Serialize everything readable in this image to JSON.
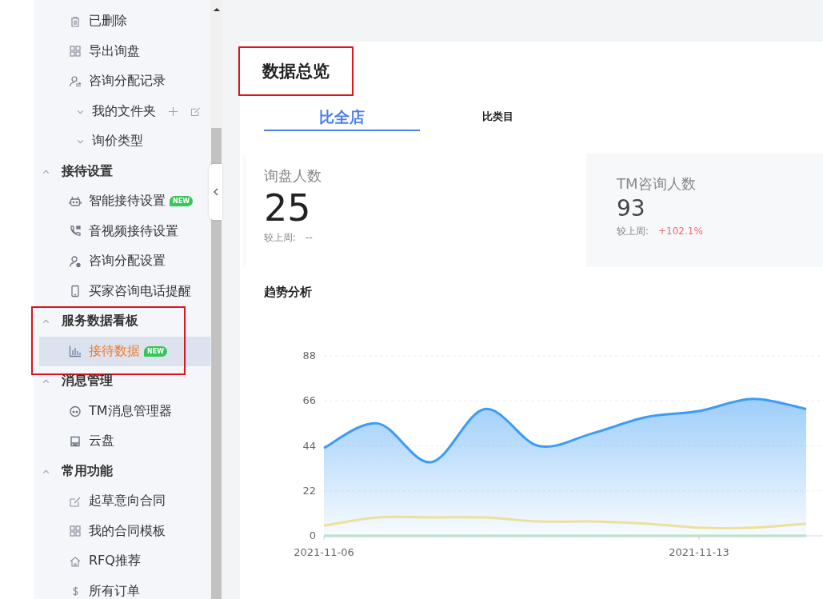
{
  "sidebar": {
    "items": [
      {
        "kind": "item",
        "label": "已删除",
        "selected": false
      },
      {
        "kind": "item",
        "label": "导出询盘",
        "selected": false
      },
      {
        "kind": "item",
        "label": "咨询分配记录",
        "selected": false
      },
      {
        "kind": "folder",
        "label": "我的文件夹",
        "expanded": false,
        "has_actions": true
      },
      {
        "kind": "folder",
        "label": "询价类型",
        "expanded": false,
        "has_actions": false
      },
      {
        "kind": "section",
        "label": "接待设置",
        "expanded": true,
        "annotated": false,
        "children": [
          {
            "kind": "item",
            "label": "智能接待设置",
            "badge": "NEW",
            "selected": false
          },
          {
            "kind": "item",
            "label": "音视频接待设置",
            "selected": false
          },
          {
            "kind": "item",
            "label": "咨询分配设置",
            "selected": false
          },
          {
            "kind": "item",
            "label": "买家咨询电话提醒",
            "selected": false
          }
        ]
      },
      {
        "kind": "section",
        "label": "服务数据看板",
        "expanded": true,
        "annotated": true,
        "children": [
          {
            "kind": "item",
            "label": "接待数据",
            "badge": "NEW",
            "selected": true
          }
        ]
      },
      {
        "kind": "section",
        "label": "消息管理",
        "expanded": true,
        "annotated": false,
        "children": [
          {
            "kind": "item",
            "label": "TM消息管理器",
            "selected": false
          },
          {
            "kind": "item",
            "label": "云盘",
            "selected": false
          }
        ]
      },
      {
        "kind": "section",
        "label": "常用功能",
        "expanded": true,
        "annotated": false,
        "children": [
          {
            "kind": "item",
            "label": "起草意向合同",
            "selected": false
          },
          {
            "kind": "item",
            "label": "我的合同模板",
            "selected": false
          },
          {
            "kind": "item",
            "label": "RFQ推荐",
            "selected": false
          },
          {
            "kind": "item",
            "label": "所有订单",
            "selected": false
          }
        ]
      }
    ]
  },
  "page": {
    "title": "数据总览",
    "title_annotated": true,
    "tabs": [
      {
        "label": "比全店",
        "selected": true
      },
      {
        "label": "比类目",
        "selected": false
      }
    ],
    "stats": [
      {
        "label": "询盘人数",
        "value": "25",
        "compare_label": "较上周:",
        "change": "--",
        "selected": true
      },
      {
        "label": "TM咨询人数",
        "value": "93",
        "compare_label": "较上周:",
        "change": "+102.1%",
        "selected": false
      }
    ],
    "trend": {
      "title": "趋势分析",
      "chart_data": {
        "type": "area",
        "categories": [
          "2021-11-06",
          null,
          null,
          null,
          null,
          null,
          null,
          "2021-11-13",
          null,
          null
        ],
        "yticks": [
          0,
          22,
          44,
          66,
          88
        ],
        "grid": true,
        "ylim": [
          0,
          88
        ],
        "series": [
          {
            "type": "area",
            "color": "#3c9cf5",
            "values": [
              43,
              55,
              36,
              62,
              44,
              50,
              58,
              61,
              67,
              62
            ]
          },
          {
            "type": "line",
            "color": "#ede09a",
            "values": [
              5,
              9,
              9,
              9,
              7,
              7,
              6,
              4,
              4,
              6
            ]
          },
          {
            "type": "line",
            "color": "#a8e0c4",
            "values": [
              0,
              0,
              0,
              0,
              0,
              0,
              0,
              0,
              0,
              0
            ]
          }
        ]
      }
    }
  }
}
